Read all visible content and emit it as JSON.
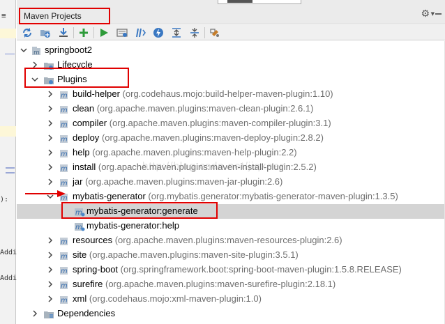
{
  "left_strip": {
    "top_glyph": "≡",
    "bracket_text": "):",
    "addi_1": "Addi",
    "addi_2": "Addi"
  },
  "panel": {
    "title": "Maven Projects",
    "gear_label": "settings",
    "collapse_label": "hide"
  },
  "toolbar": {
    "buttons": [
      "reimport-icon",
      "generate-sources-icon",
      "download-icon",
      "add-icon",
      "run-icon",
      "toggle-offline-icon",
      "skip-tests-icon",
      "lifecycle-icon",
      "expand-all-icon",
      "collapse-all-icon",
      "settings-icon"
    ]
  },
  "tree": {
    "project": "springboot2",
    "lifecycle": "Lifecycle",
    "plugins": "Plugins",
    "plugin_list": [
      {
        "name": "build-helper",
        "coord": "(org.codehaus.mojo:build-helper-maven-plugin:1.10)"
      },
      {
        "name": "clean",
        "coord": "(org.apache.maven.plugins:maven-clean-plugin:2.6.1)"
      },
      {
        "name": "compiler",
        "coord": "(org.apache.maven.plugins:maven-compiler-plugin:3.1)"
      },
      {
        "name": "deploy",
        "coord": "(org.apache.maven.plugins:maven-deploy-plugin:2.8.2)"
      },
      {
        "name": "help",
        "coord": "(org.apache.maven.plugins:maven-help-plugin:2.2)"
      },
      {
        "name": "install",
        "coord": "(org.apache.maven.plugins:maven-install-plugin:2.5.2)"
      },
      {
        "name": "jar",
        "coord": "(org.apache.maven.plugins:maven-jar-plugin:2.6)"
      },
      {
        "name": "mybatis-generator",
        "coord": "(org.mybatis.generator:mybatis-generator-maven-plugin:1.3.5)"
      }
    ],
    "goals": [
      "mybatis-generator:generate",
      "mybatis-generator:help"
    ],
    "plugin_list_after": [
      {
        "name": "resources",
        "coord": "(org.apache.maven.plugins:maven-resources-plugin:2.6)"
      },
      {
        "name": "site",
        "coord": "(org.apache.maven.plugins:maven-site-plugin:3.5.1)"
      },
      {
        "name": "spring-boot",
        "coord": "(org.springframework.boot:spring-boot-maven-plugin:1.5.8.RELEASE)"
      },
      {
        "name": "surefire",
        "coord": "(org.apache.maven.plugins:maven-surefire-plugin:2.18.1)"
      },
      {
        "name": "xml",
        "coord": "(org.codehaus.mojo:xml-maven-plugin:1.0)"
      }
    ],
    "dependencies": "Dependencies"
  },
  "watermark": "http://blog.csdn.net/jiqxeen",
  "colors": {
    "highlight_box": "#e00000",
    "selected_row": "#d4d4d4",
    "folder_blue": "#4a86c8",
    "run_green": "#2e9b3a"
  }
}
